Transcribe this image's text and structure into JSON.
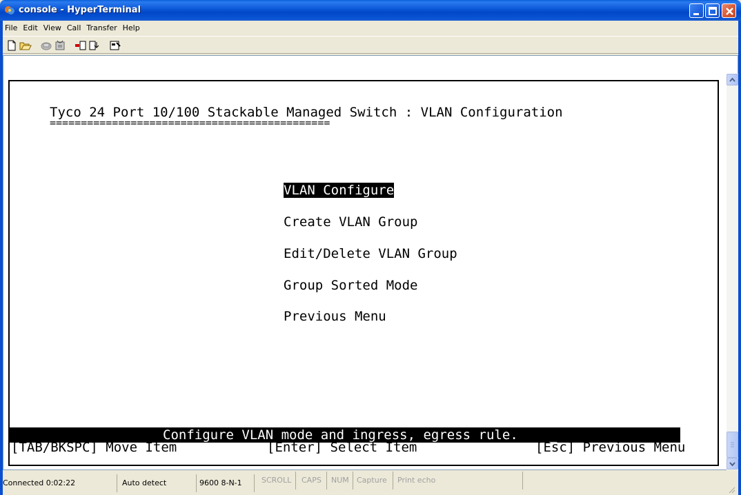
{
  "window": {
    "title": "console - HyperTerminal"
  },
  "menu": [
    "File",
    "Edit",
    "View",
    "Call",
    "Transfer",
    "Help"
  ],
  "toolbar": {
    "icons": [
      "new-icon",
      "open-icon",
      "disconnect-icon",
      "connect-icon",
      "send-icon",
      "receive-icon",
      "properties-icon"
    ]
  },
  "terminal": {
    "header": "Tyco 24 Port 10/100 Stackable Managed Switch : VLAN Configuration",
    "underline": "=============================================",
    "menu_items": [
      "VLAN Configure",
      "Create VLAN Group",
      "Edit/Delete VLAN Group",
      "Group Sorted Mode",
      "Previous Menu"
    ],
    "selected_index": 0,
    "status_message": "Configure VLAN mode and ingress, egress rule.",
    "cursor": "_",
    "help_tab": "[TAB/BKSPC] Move Item",
    "help_enter": "[Enter] Select Item",
    "help_esc": "[Esc] Previous Menu"
  },
  "statusbar": {
    "connected": "Connected 0:02:22",
    "detect": "Auto detect",
    "port": "9600 8-N-1",
    "scroll": "SCROLL",
    "caps": "CAPS",
    "num": "NUM",
    "capture": "Capture",
    "print_echo": "Print echo"
  },
  "colors": {
    "titlebar": "#0a55d4",
    "terminal_bg": "#ffffff",
    "terminal_fg": "#000000",
    "highlight_bg": "#000000"
  }
}
